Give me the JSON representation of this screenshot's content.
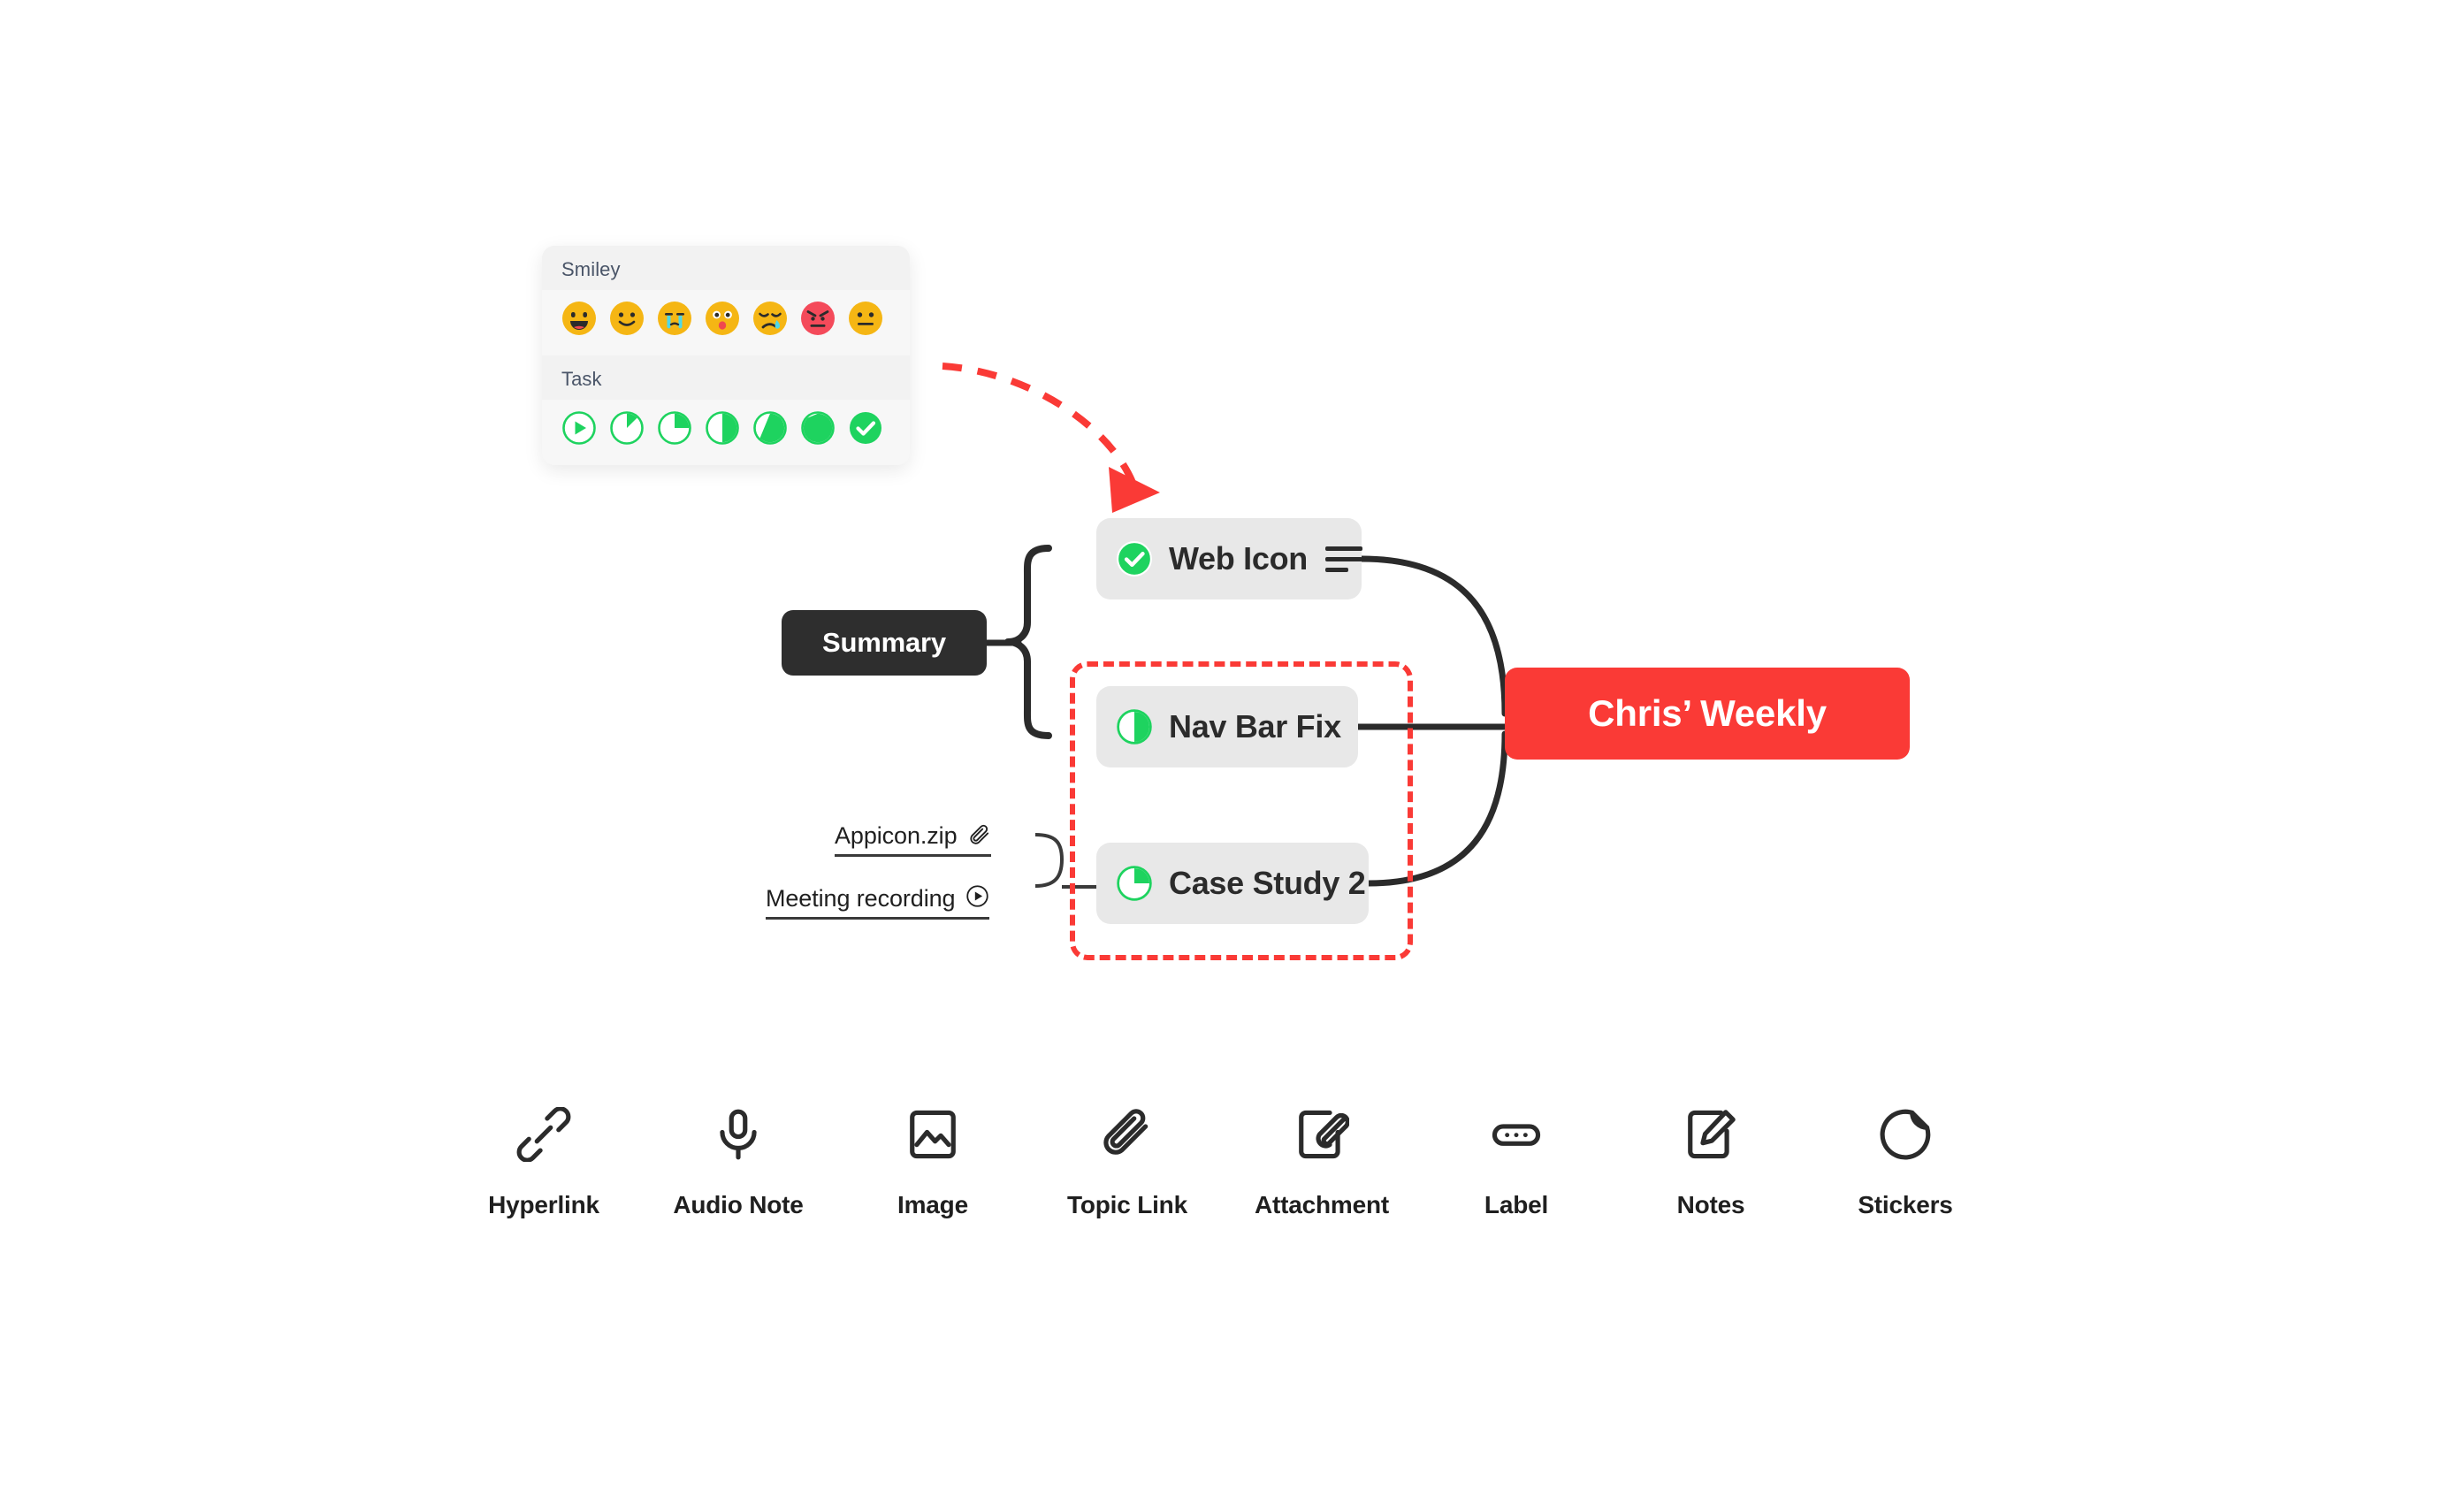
{
  "picker": {
    "sections": [
      {
        "title": "Smiley",
        "items": [
          {
            "name": "emoji-grinning",
            "label": "Grinning"
          },
          {
            "name": "emoji-smiling",
            "label": "Smiling"
          },
          {
            "name": "emoji-crying",
            "label": "Crying"
          },
          {
            "name": "emoji-astonished",
            "label": "Astonished"
          },
          {
            "name": "emoji-sad-tear",
            "label": "Sad with tear"
          },
          {
            "name": "emoji-angry",
            "label": "Angry"
          },
          {
            "name": "emoji-neutral",
            "label": "Neutral"
          }
        ]
      },
      {
        "title": "Task",
        "items": [
          {
            "name": "task-start",
            "label": "Start",
            "progress": 0
          },
          {
            "name": "task-progress-12",
            "label": "12%",
            "progress": 12.5
          },
          {
            "name": "task-progress-25",
            "label": "25%",
            "progress": 25
          },
          {
            "name": "task-progress-50",
            "label": "50%",
            "progress": 50
          },
          {
            "name": "task-progress-62",
            "label": "62%",
            "progress": 62.5
          },
          {
            "name": "task-progress-87",
            "label": "87%",
            "progress": 87.5
          },
          {
            "name": "task-done",
            "label": "Done",
            "progress": 100
          }
        ]
      }
    ]
  },
  "map": {
    "central": {
      "title": "Chris’ Weekly"
    },
    "summary": {
      "label": "Summary"
    },
    "nodes": [
      {
        "label": "Web Icon",
        "progress": 100,
        "has_notes": true
      },
      {
        "label": "Nav Bar Fix",
        "progress": 50,
        "has_notes": false
      },
      {
        "label": "Case Study 2",
        "progress": 25,
        "has_notes": false
      }
    ],
    "attachments": [
      {
        "label": "Appicon.zip",
        "icon": "paperclip-icon"
      },
      {
        "label": "Meeting recording",
        "icon": "play-circle-icon"
      }
    ]
  },
  "toolbar": {
    "items": [
      {
        "label": "Hyperlink",
        "icon": "hyperlink-icon"
      },
      {
        "label": "Audio Note",
        "icon": "microphone-icon"
      },
      {
        "label": "Image",
        "icon": "image-icon"
      },
      {
        "label": "Topic Link",
        "icon": "paperclip-icon"
      },
      {
        "label": "Attachment",
        "icon": "document-paperclip-icon"
      },
      {
        "label": "Label",
        "icon": "label-pill-icon"
      },
      {
        "label": "Notes",
        "icon": "document-pencil-icon"
      },
      {
        "label": "Stickers",
        "icon": "sticker-peel-icon"
      }
    ]
  },
  "colors": {
    "accent_red": "#fa3a36",
    "task_green": "#1ed35f",
    "emoji_yellow": "#f5b614",
    "emoji_red": "#f44a5a",
    "node_gray": "#e8e8e8",
    "summary_dark": "#2e2e2e"
  }
}
